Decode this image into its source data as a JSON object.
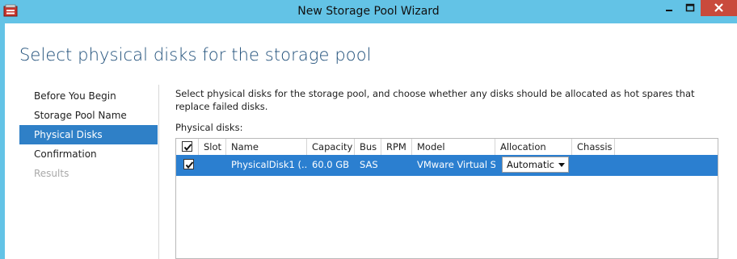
{
  "window": {
    "title": "New Storage Pool Wizard"
  },
  "page": {
    "title": "Select physical disks for the storage pool"
  },
  "nav": {
    "items": [
      {
        "label": "Before You Begin",
        "state": "normal"
      },
      {
        "label": "Storage Pool Name",
        "state": "normal"
      },
      {
        "label": "Physical Disks",
        "state": "active"
      },
      {
        "label": "Confirmation",
        "state": "normal"
      },
      {
        "label": "Results",
        "state": "disabled"
      }
    ]
  },
  "content": {
    "description": "Select physical disks for the storage pool, and choose whether any disks should be allocated as hot spares that replace failed disks.",
    "disks_label": "Physical disks:"
  },
  "grid": {
    "columns": [
      "Slot",
      "Name",
      "Capacity",
      "Bus",
      "RPM",
      "Model",
      "Allocation",
      "Chassis"
    ],
    "header_checkbox_checked": true,
    "rows": [
      {
        "checked": true,
        "slot": "",
        "name": "PhysicalDisk1 (...",
        "capacity": "60.0 GB",
        "bus": "SAS",
        "rpm": "",
        "model": "VMware Virtual S",
        "allocation": "Automatic",
        "chassis": ""
      }
    ]
  },
  "colors": {
    "titlebar": "#63c3e6",
    "accent": "#2f80c7",
    "selected_row": "#2b7fd0",
    "close_button": "#c94a3c",
    "page_title": "#1e4e79"
  }
}
